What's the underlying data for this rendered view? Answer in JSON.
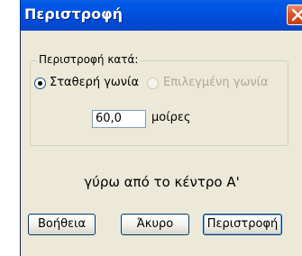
{
  "dialog": {
    "title": "Περιστροφή",
    "close_icon": "close-icon"
  },
  "rotate_by_group": {
    "legend": "Περιστροφή κατά:",
    "options": [
      {
        "label": "Σταθερή γωνία",
        "checked": true,
        "enabled": true
      },
      {
        "label": "Επιλεγμένη γωνία",
        "checked": false,
        "enabled": false
      }
    ],
    "angle_value": "60,0",
    "unit_label": "μοίρες"
  },
  "center_text": "γύρω από το κέντρο A'",
  "buttons": {
    "help": "Βοήθεια",
    "cancel": "Άκυρο",
    "rotate": "Περιστροφή"
  },
  "colors": {
    "titlebar": "#0053e1",
    "close_button": "#d9532b",
    "window_background": "#ece9d8",
    "disabled_text": "#aca899"
  }
}
